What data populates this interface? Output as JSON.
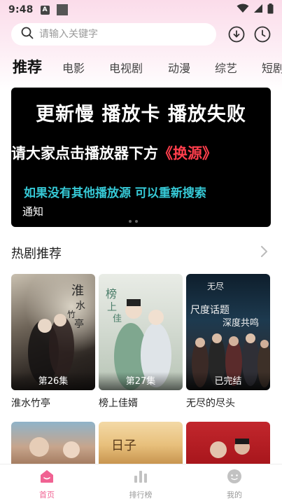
{
  "status_bar": {
    "time": "9:48",
    "notification_letter": "A"
  },
  "search": {
    "placeholder": "请输入关键字"
  },
  "tabs": [
    {
      "label": "推荐",
      "active": true
    },
    {
      "label": "电影"
    },
    {
      "label": "电视剧"
    },
    {
      "label": "动漫"
    },
    {
      "label": "综艺"
    },
    {
      "label": "短剧"
    }
  ],
  "banner": {
    "line1": "更新慢 播放卡 播放失败",
    "line2_main": "请大家点击播放器下方",
    "line2_highlight": "《换源》",
    "line3": "如果没有其他播放源 可以重新搜索",
    "notice": "通知"
  },
  "section": {
    "title": "热剧推荐"
  },
  "cards": [
    {
      "title": "淮水竹亭",
      "badge": "第26集"
    },
    {
      "title": "榜上佳婿",
      "badge": "第27集"
    },
    {
      "title": "无尽的尽头",
      "badge": "已完结"
    }
  ],
  "bottom_nav": [
    {
      "label": "首页",
      "active": true
    },
    {
      "label": "排行榜"
    },
    {
      "label": "我的"
    }
  ],
  "colors": {
    "accent": "#f06292",
    "banner_highlight": "#ff3e4c",
    "banner_teal": "#36c9d6",
    "nav_inactive": "#b0b0b0"
  }
}
